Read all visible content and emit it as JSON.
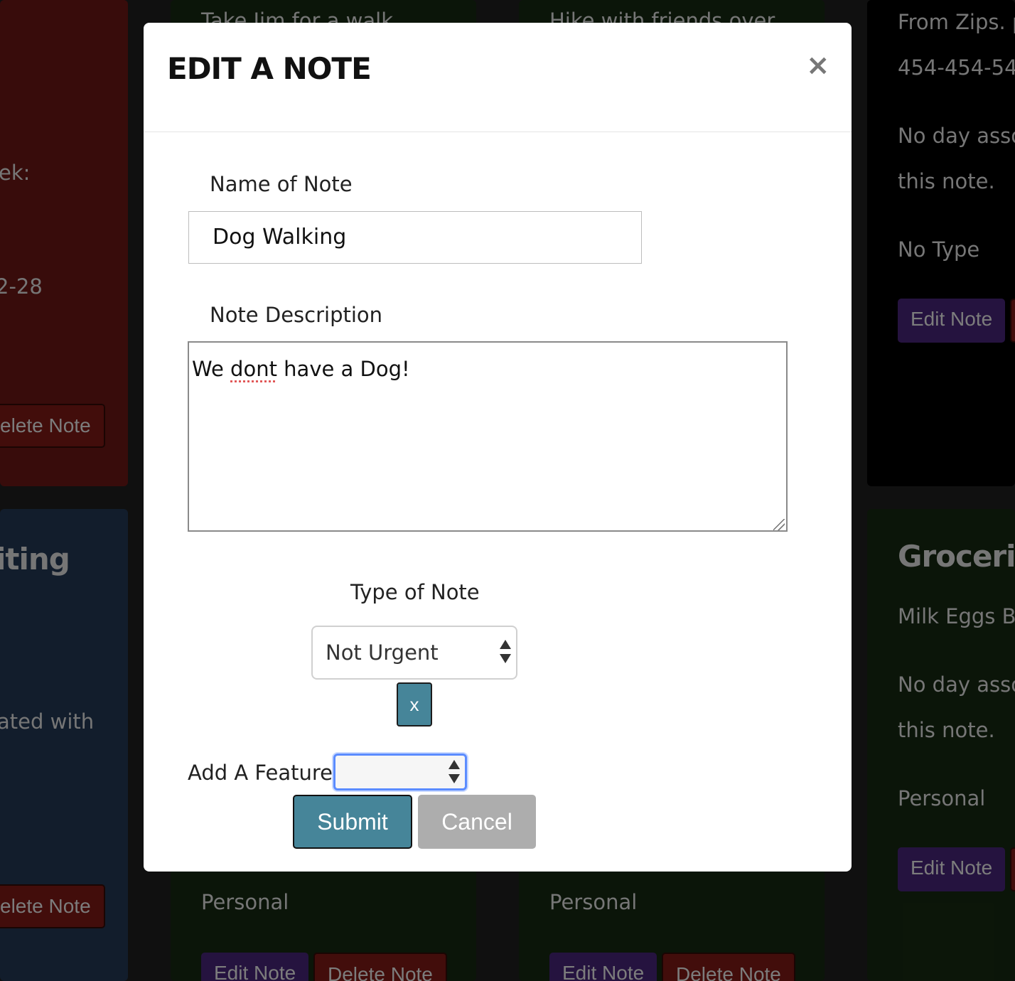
{
  "background_cards": {
    "left_top": {
      "fragment_1": "ek:",
      "fragment_2": "2-28",
      "delete_button": "elete Note"
    },
    "left_bottom": {
      "title_fragment": "iting",
      "fragment_1": "ated with",
      "delete_button": "elete Note"
    },
    "mid_top_1": {
      "text": "Take Jim for a walk"
    },
    "mid_top_2": {
      "text": "Hike with friends over"
    },
    "mid_bottom_1": {
      "type": "Personal",
      "edit_button": "Edit Note",
      "delete_button": "Delete Note"
    },
    "mid_bottom_2": {
      "type": "Personal",
      "edit_button": "Edit Note",
      "delete_button": "Delete Note"
    },
    "right_top": {
      "line_1": "From Zips. p",
      "line_2": "454-454-54",
      "line_3": "No day asso",
      "line_4": "this note.",
      "type": "No Type",
      "edit_button": "Edit Note"
    },
    "right_bottom": {
      "title": "Groceries",
      "line_1": "Milk Eggs Ba",
      "line_2": "No day asso",
      "line_3": "this note.",
      "type": "Personal",
      "edit_button": "Edit Note"
    }
  },
  "modal": {
    "title": "EDIT A NOTE",
    "close_label": "×",
    "name_label": "Name of Note",
    "name_value": "Dog Walking",
    "description_label": "Note Description",
    "description_value_before": "We ",
    "description_value_misspelled": "dont",
    "description_value_after": " have a Dog!",
    "type_label": "Type of Note",
    "type_selected": "Not Urgent",
    "remove_label": "x",
    "feature_label": "Add A Feature",
    "feature_selected": "",
    "submit_label": "Submit",
    "cancel_label": "Cancel"
  },
  "colors": {
    "primary_button": "#468599",
    "cancel_button": "#adadad",
    "card_red": "#5b1412",
    "card_blue": "#1e3047",
    "card_green": "#13230f",
    "card_black": "#000000",
    "button_purple": "#3d1f66"
  },
  "icons": {
    "close": "close-icon",
    "select_arrows": "updown-arrows-icon",
    "resize": "resize-grip-icon"
  }
}
